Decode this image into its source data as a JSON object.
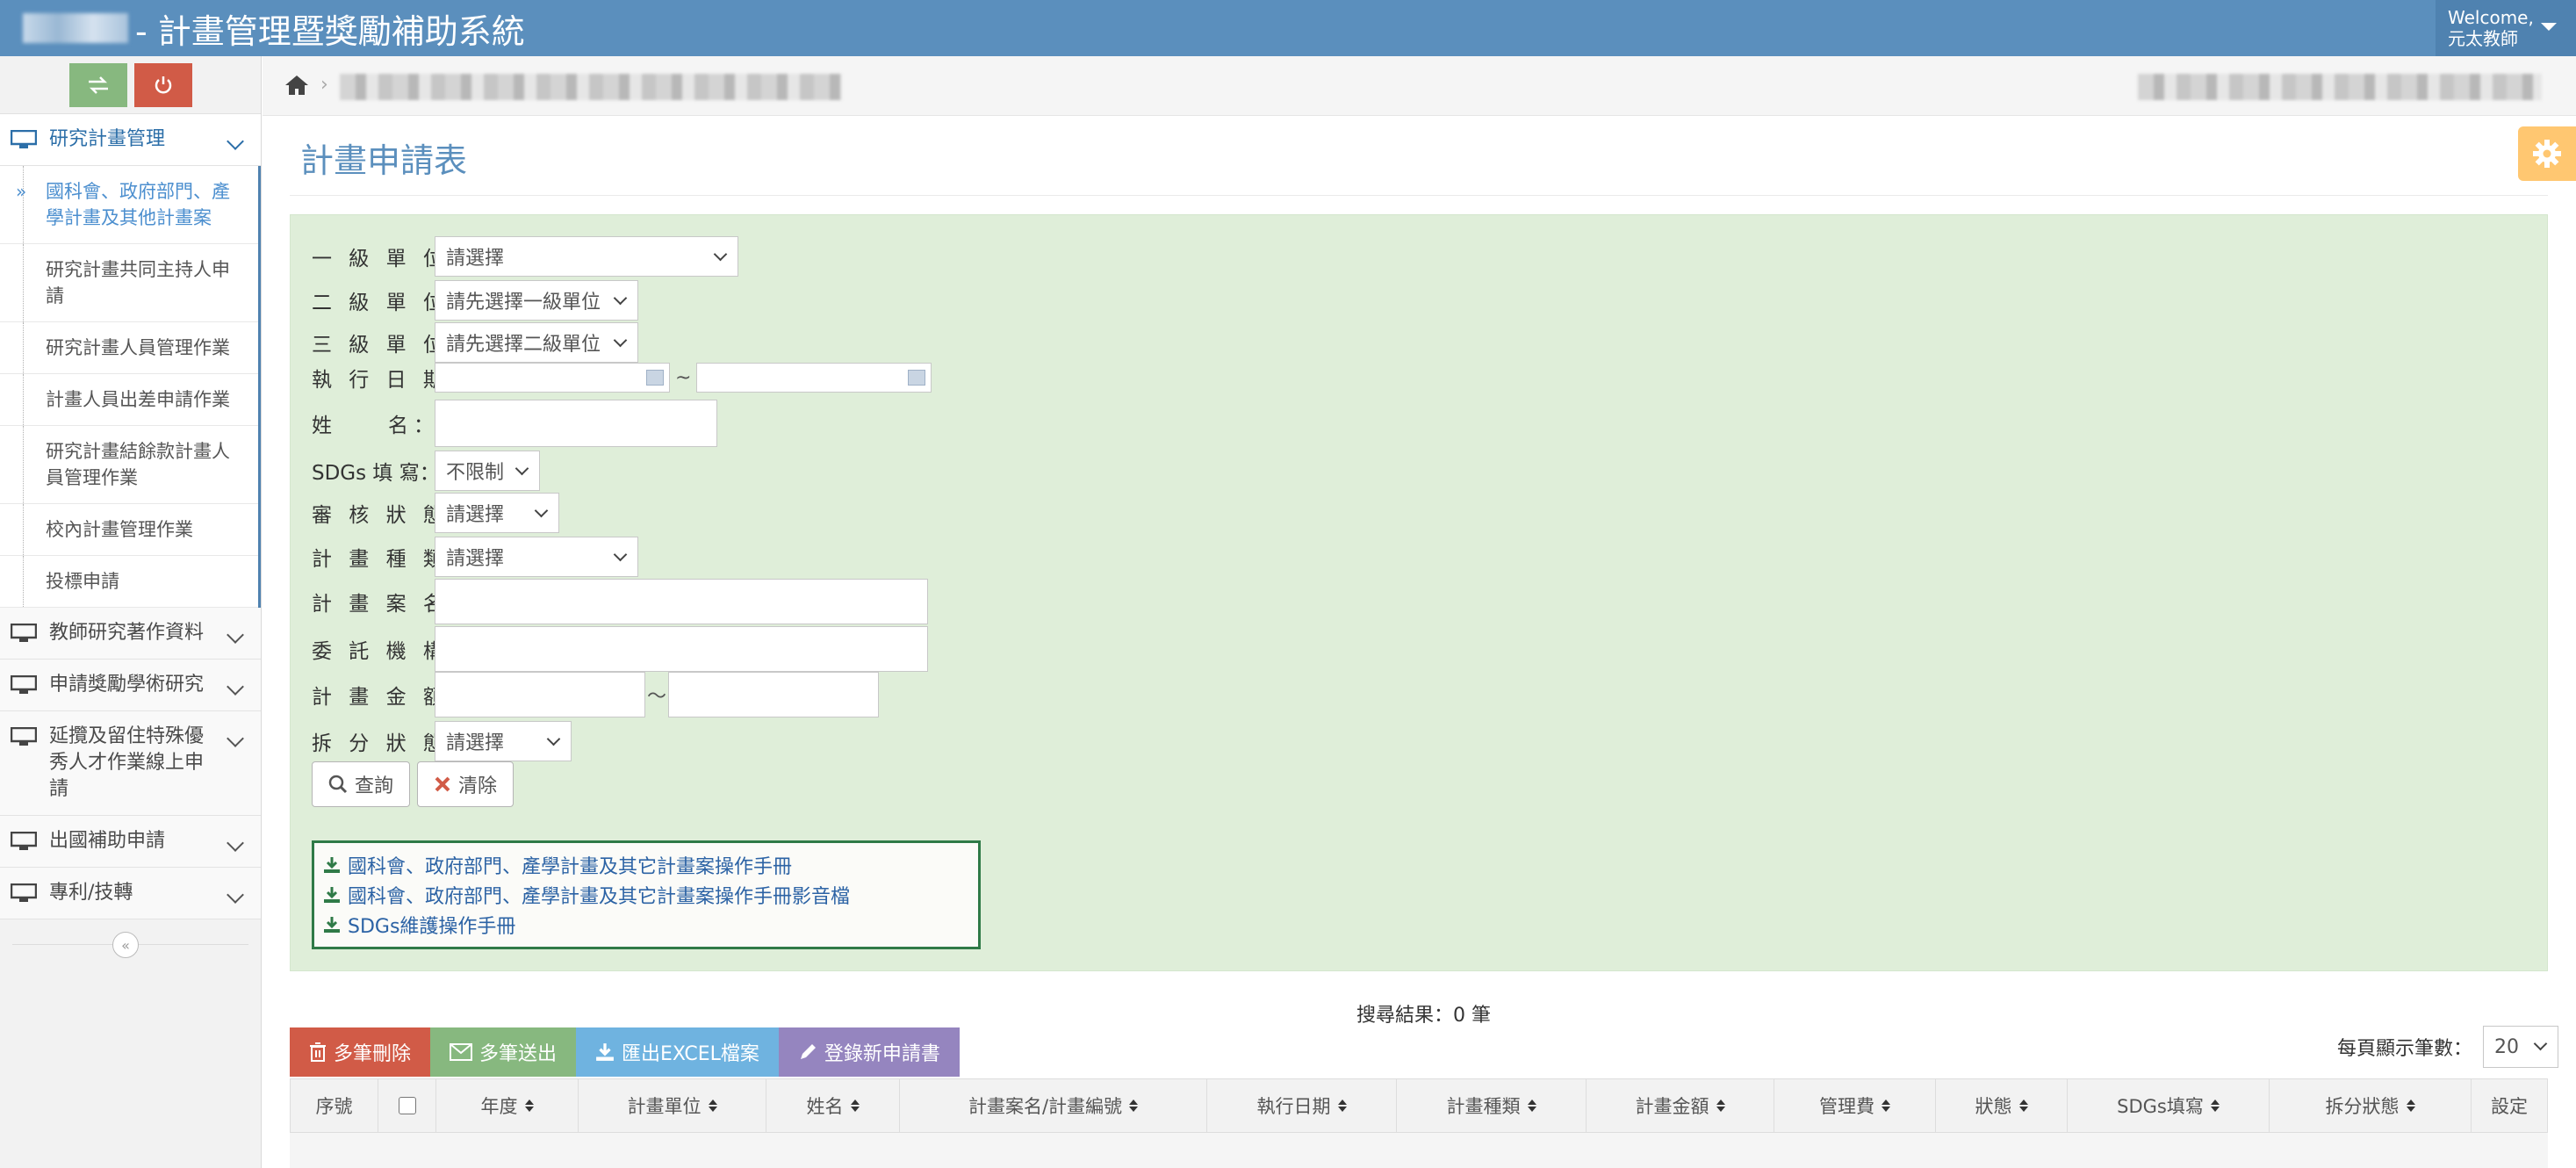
{
  "topbar": {
    "system_title": "- 計畫管理暨獎勵補助系統",
    "welcome": "Welcome,",
    "user_name": "元太教師"
  },
  "sidebar": {
    "menus": [
      {
        "label": "研究計畫管理",
        "expanded": true
      },
      {
        "label": "教師研究著作資料"
      },
      {
        "label": "申請獎勵學術研究"
      },
      {
        "label": "延攬及留住特殊優秀人才作業線上申請"
      },
      {
        "label": "出國補助申請"
      },
      {
        "label": "專利/技轉"
      }
    ],
    "submenu": [
      {
        "label": "國科會、政府部門、產學計畫及其他計畫案",
        "active": true
      },
      {
        "label": "研究計畫共同主持人申請"
      },
      {
        "label": "研究計畫人員管理作業"
      },
      {
        "label": "計畫人員出差申請作業"
      },
      {
        "label": "研究計畫結餘款計畫人員管理作業"
      },
      {
        "label": "校內計畫管理作業"
      },
      {
        "label": "投標申請"
      }
    ],
    "submenu_arrow": "»"
  },
  "page": {
    "title": "計畫申請表"
  },
  "form": {
    "unit1": {
      "label": "一 級 單 位：",
      "value": "請選擇"
    },
    "unit2": {
      "label": "二 級 單 位：",
      "value": "請先選擇一級單位"
    },
    "unit3": {
      "label": "三 級 單 位：",
      "value": "請先選擇二級單位"
    },
    "exec_date": {
      "label": "執 行 日 期：",
      "separator": "~"
    },
    "name": {
      "label": "姓　　名："
    },
    "sdgs": {
      "label": "SDGs 填 寫：",
      "value": "不限制"
    },
    "review_status": {
      "label": "審 核 狀 態：",
      "value": "請選擇"
    },
    "plan_type": {
      "label": "計 畫 種 類：",
      "value": "請選擇"
    },
    "plan_name": {
      "label": "計 畫 案 名："
    },
    "agency": {
      "label": "委 託 機 構："
    },
    "amount": {
      "label": "計 畫 金 額：",
      "separator": "～"
    },
    "split_status": {
      "label": "拆 分 狀 態：",
      "value": "請選擇"
    },
    "query_button": "查詢",
    "clear_button": "清除"
  },
  "docs": [
    "國科會、政府部門、產學計畫及其它計畫案操作手冊",
    "國科會、政府部門、產學計畫及其它計畫案操作手冊影音檔",
    "SDGs維護操作手冊"
  ],
  "results": {
    "count_text": "搜尋結果：0 筆"
  },
  "toolbar": {
    "bulk_delete": "多筆刪除",
    "bulk_send": "多筆送出",
    "export_excel": "匯出EXCEL檔案",
    "new_application": "登錄新申請書",
    "per_page_label": "每頁顯示筆數：",
    "per_page_value": "20"
  },
  "table": {
    "columns": [
      "序號",
      "",
      "年度",
      "計畫單位",
      "姓名",
      "計畫案名/計畫編號",
      "執行日期",
      "計畫種類",
      "計畫金額",
      "管理費",
      "狀態",
      "SDGs填寫",
      "拆分狀態",
      "設定"
    ]
  },
  "colors": {
    "topbar": "#5b8fbd",
    "panel": "#dfeed9",
    "delete": "#d15b47",
    "send": "#87b87f",
    "excel": "#6fb3e0",
    "new": "#9585bf",
    "settings": "#ffc771"
  }
}
